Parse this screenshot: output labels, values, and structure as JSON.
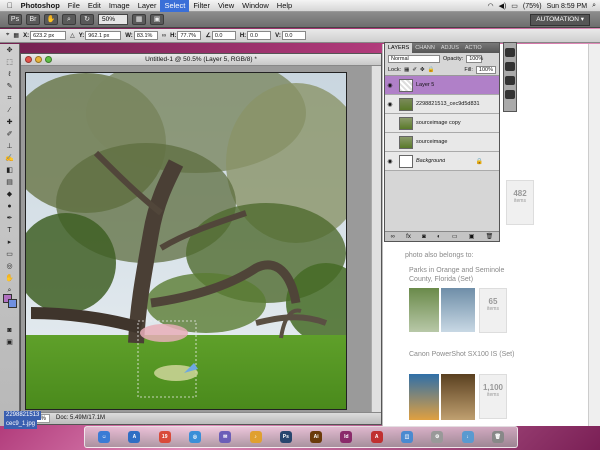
{
  "menubar": {
    "apple": "",
    "app": "Photoshop",
    "items": [
      "File",
      "Edit",
      "Image",
      "Layer",
      "Select",
      "Filter",
      "View",
      "Window",
      "Help"
    ],
    "active_index": 4,
    "battery": "(75%)",
    "clock": "Sun 8:59 PM"
  },
  "appbar": {
    "zoom": "50%",
    "workspace": "AUTOMATION ▾"
  },
  "options": {
    "x_label": "X:",
    "x_value": "623.2 px",
    "y_label": "Y:",
    "y_value": "962.1 px",
    "w_label": "W:",
    "w_value": "83.1%",
    "h_label": "H:",
    "h_value": "77.7%",
    "angle_value": "0.0",
    "h_skew_label": "H:",
    "h_skew_value": "0.0",
    "v_skew_label": "V:",
    "v_skew_value": "0.0"
  },
  "document": {
    "title": "Untitled-1 @ 50.5% (Layer 5, RGB/8) *",
    "zoom": "50.5%",
    "doc_info": "Doc: 5.49M/17.1M"
  },
  "layers_panel": {
    "tabs": [
      "LAYERS",
      "CHANN",
      "ADJUS",
      "ACTIO"
    ],
    "blend_mode": "Normal",
    "opacity_label": "Opacity:",
    "opacity": "100%",
    "lock_label": "Lock:",
    "fill_label": "Fill:",
    "fill": "100%",
    "layers": [
      {
        "name": "Layer 5",
        "visible": true,
        "selected": true
      },
      {
        "name": "2298821513_cec9d5d831",
        "visible": true,
        "selected": false
      },
      {
        "name": "sourceimage copy",
        "visible": false,
        "selected": false
      },
      {
        "name": "sourceimage",
        "visible": false,
        "selected": false
      },
      {
        "name": "Background",
        "visible": true,
        "selected": false,
        "locked": true
      }
    ],
    "footer_icons": [
      "link-icon",
      "fx-icon",
      "mask-icon",
      "adjustment-icon",
      "group-icon",
      "new-layer-icon",
      "trash-icon"
    ]
  },
  "browser": {
    "count1": "482",
    "count1_unit": "items",
    "belongs_to": "photo also belongs to:",
    "set1": "Parks in Orange and Seminole County, Florida (Set)",
    "count2": "65",
    "count2_unit": "items",
    "set2": "Canon PowerShot SX100 IS (Set)",
    "count3": "1,100",
    "count3_unit": "items"
  },
  "desktop_file": {
    "name_line1": "2298821513",
    "name_line2": "cec9_1.jpg"
  },
  "tools": [
    "move",
    "marquee",
    "lasso",
    "quick-select",
    "crop",
    "eyedropper",
    "healing",
    "brush",
    "stamp",
    "history",
    "eraser",
    "gradient",
    "blur",
    "dodge",
    "pen",
    "type",
    "path-select",
    "shape",
    "3d",
    "hand",
    "zoom"
  ],
  "colors": {
    "selected_layer": "#b080c8",
    "foreground": "#b070c0",
    "background": "#7090e0"
  }
}
